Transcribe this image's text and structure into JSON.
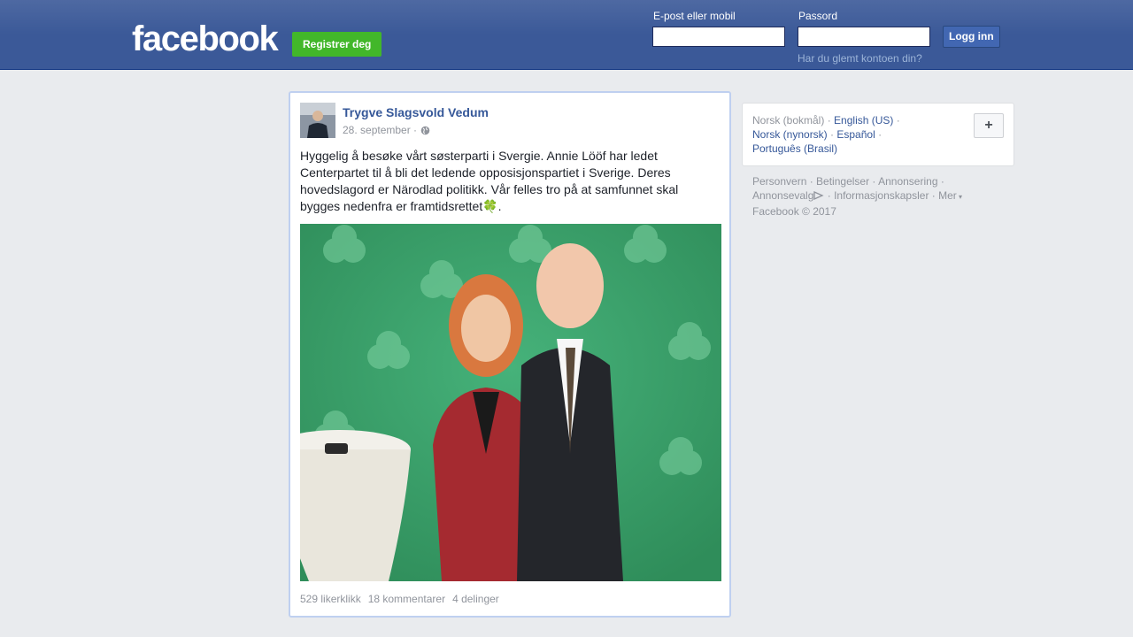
{
  "header": {
    "logo": "facebook",
    "register_label": "Registrer deg",
    "email_label": "E-post eller mobil",
    "email_value": "",
    "password_label": "Passord",
    "password_value": "",
    "login_label": "Logg inn",
    "forgot_label": "Har du glemt kontoen din?"
  },
  "post": {
    "author": "Trygve Slagsvold Vedum",
    "date": "28. september ·",
    "privacy_icon": "globe-icon",
    "text": "Hyggelig å besøke vårt søsterparti i Svergie. Annie Lööf har ledet Centerpartet til å bli det ledende opposisjonspartiet i Sverige. Deres hovedslagord er Närodlad politikk. Vår felles tro på at samfunnet skal bygges nedenfra er framtidsrettet🍀.",
    "likes": "529 likerklikk",
    "comments": "18 kommentarer",
    "shares": "4 delinger"
  },
  "languages": {
    "current": "Norsk (bokmål)",
    "options": [
      "English (US)",
      "Norsk (nynorsk)",
      "Español",
      "Português (Brasil)"
    ],
    "add_label": "+"
  },
  "footer": {
    "links": [
      "Personvern",
      "Betingelser",
      "Annonsering",
      "Annonsevalg",
      "Informasjonskapsler",
      "Mer"
    ],
    "copyright": "Facebook © 2017"
  },
  "colors": {
    "brand": "#3b5998",
    "register_green": "#42b72a",
    "link": "#365899"
  }
}
